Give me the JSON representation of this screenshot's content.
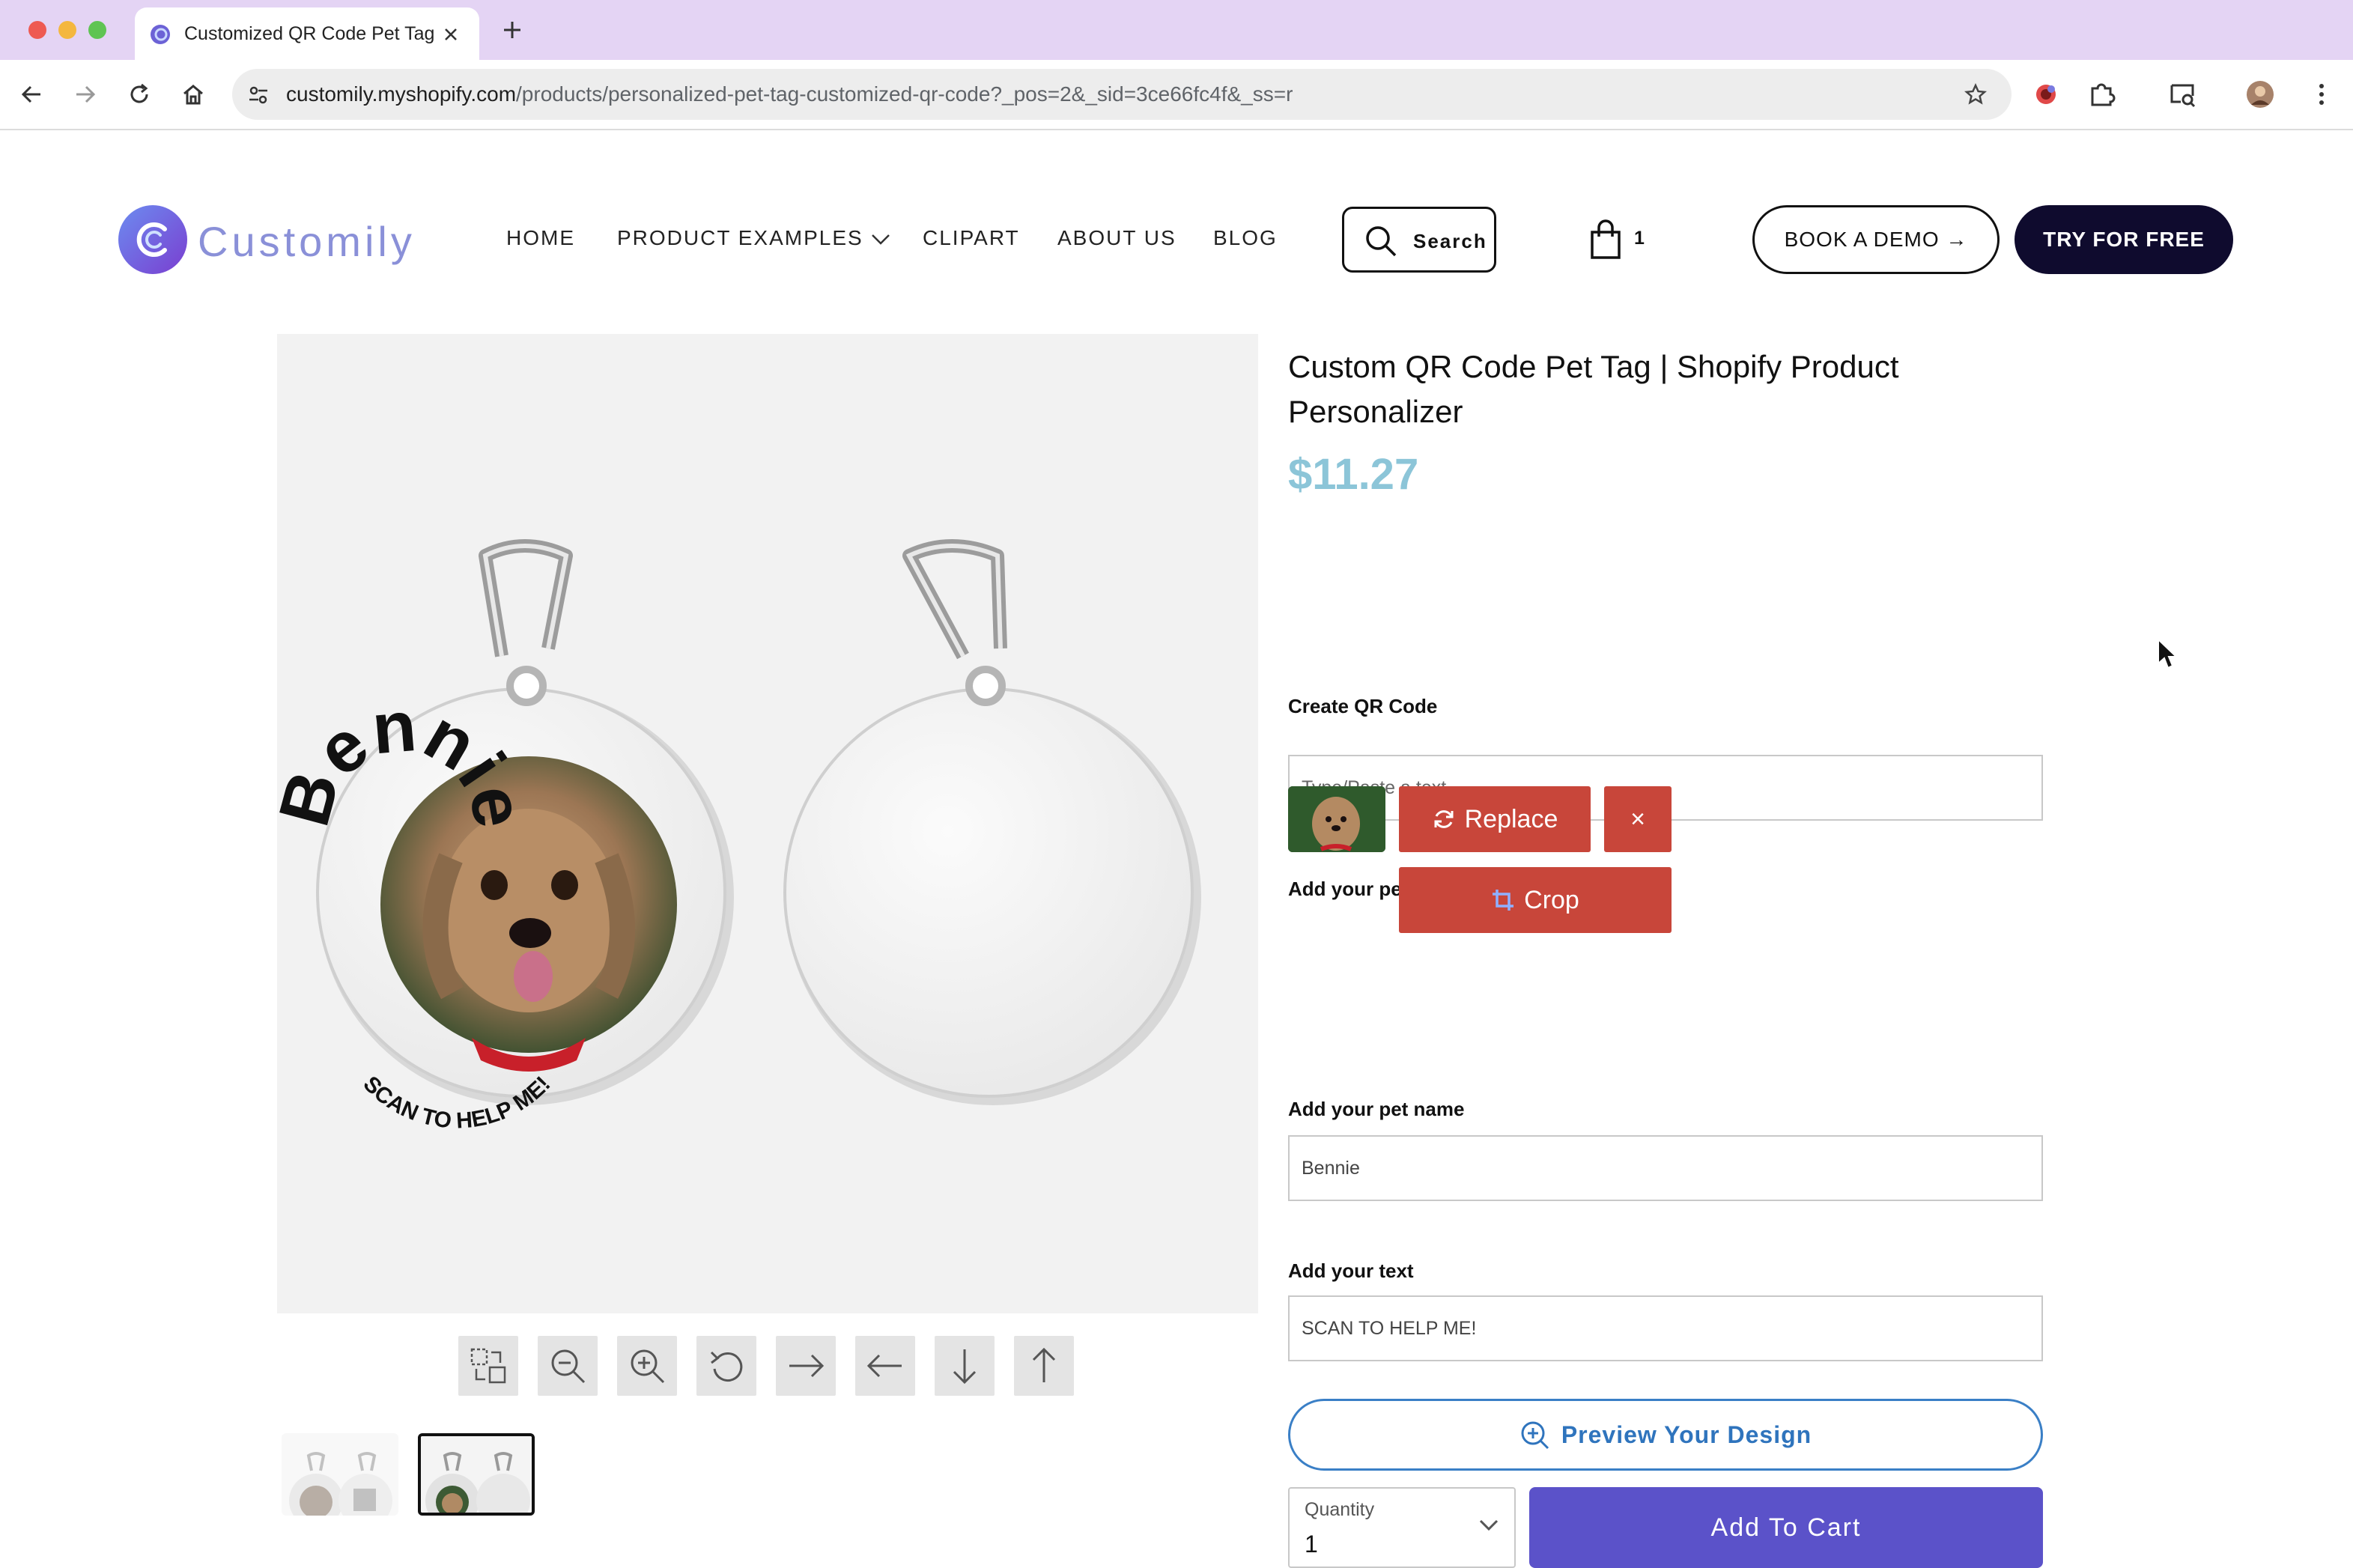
{
  "browser": {
    "tab_title": "Customized QR Code Pet Tag",
    "url_host": "customily.myshopify.com",
    "url_path": "/products/personalized-pet-tag-customized-qr-code?_pos=2&_sid=3ce66fc4f&_ss=r",
    "traffic_light_colors": [
      "#ee5a52",
      "#f4b73f",
      "#5fc453"
    ]
  },
  "header": {
    "logo_text": "Customily",
    "nav": [
      {
        "label": "HOME"
      },
      {
        "label": "PRODUCT EXAMPLES"
      },
      {
        "label": "CLIPART"
      },
      {
        "label": "ABOUT US"
      },
      {
        "label": "BLOG"
      }
    ],
    "search_label": "Search",
    "cart_count": "1",
    "demo_label": "BOOK A DEMO →",
    "try_label": "TRY FOR FREE"
  },
  "preview": {
    "pet_name_on_tag": "Bennie",
    "bottom_text_on_tag": "SCAN TO HELP ME!",
    "tools": [
      {
        "icon": "fit-icon"
      },
      {
        "icon": "zoom-out-icon"
      },
      {
        "icon": "zoom-in-icon"
      },
      {
        "icon": "rotate-icon"
      },
      {
        "icon": "arrow-right-icon"
      },
      {
        "icon": "arrow-left-icon"
      },
      {
        "icon": "arrow-down-icon"
      },
      {
        "icon": "arrow-up-icon"
      }
    ]
  },
  "product": {
    "title": "Custom QR Code Pet Tag | Shopify Product Personalizer",
    "price": "$11.27",
    "qr_label": "Create QR Code",
    "qr_placeholder": "Type/Paste a text",
    "photo_label": "Add your pet photo",
    "replace_label": "Replace",
    "remove_label": "×",
    "crop_label": "Crop",
    "name_label": "Add your pet name",
    "name_value": "Bennie",
    "text_label": "Add your text",
    "text_value": "SCAN TO HELP ME!",
    "preview_label": "Preview Your Design",
    "quantity_label": "Quantity",
    "quantity_value": "1",
    "add_to_cart_label": "Add To Cart"
  },
  "colors": {
    "accent_purple": "#5b52c9",
    "red_button": "#c8463a",
    "price": "#8cc5d8",
    "dark_cta": "#0f0b2e",
    "preview_blue": "#2f74bd"
  }
}
